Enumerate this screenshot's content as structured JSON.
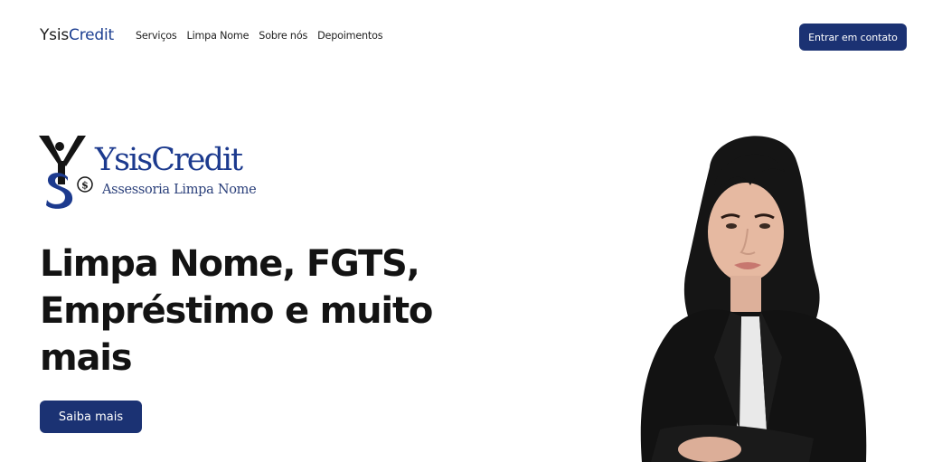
{
  "header": {
    "brand_part1": "Ysis",
    "brand_part2": "Credit",
    "nav": [
      "Serviços",
      "Limpa Nome",
      "Sobre nós",
      "Depoimentos"
    ],
    "cta": "Entrar em contato"
  },
  "hero": {
    "logo_name": "YsisCredit",
    "logo_tagline": "Assessoria Limpa Nome",
    "headline": "Limpa Nome, FGTS, Empréstimo e muito mais",
    "cta": "Saiba mais"
  },
  "colors": {
    "brand_blue": "#1c3f91",
    "button_navy": "#1b3273",
    "text_dark": "#131313"
  },
  "icons": {
    "logo_mark": "ys-dollar-monogram",
    "portrait": "woman-portrait"
  }
}
